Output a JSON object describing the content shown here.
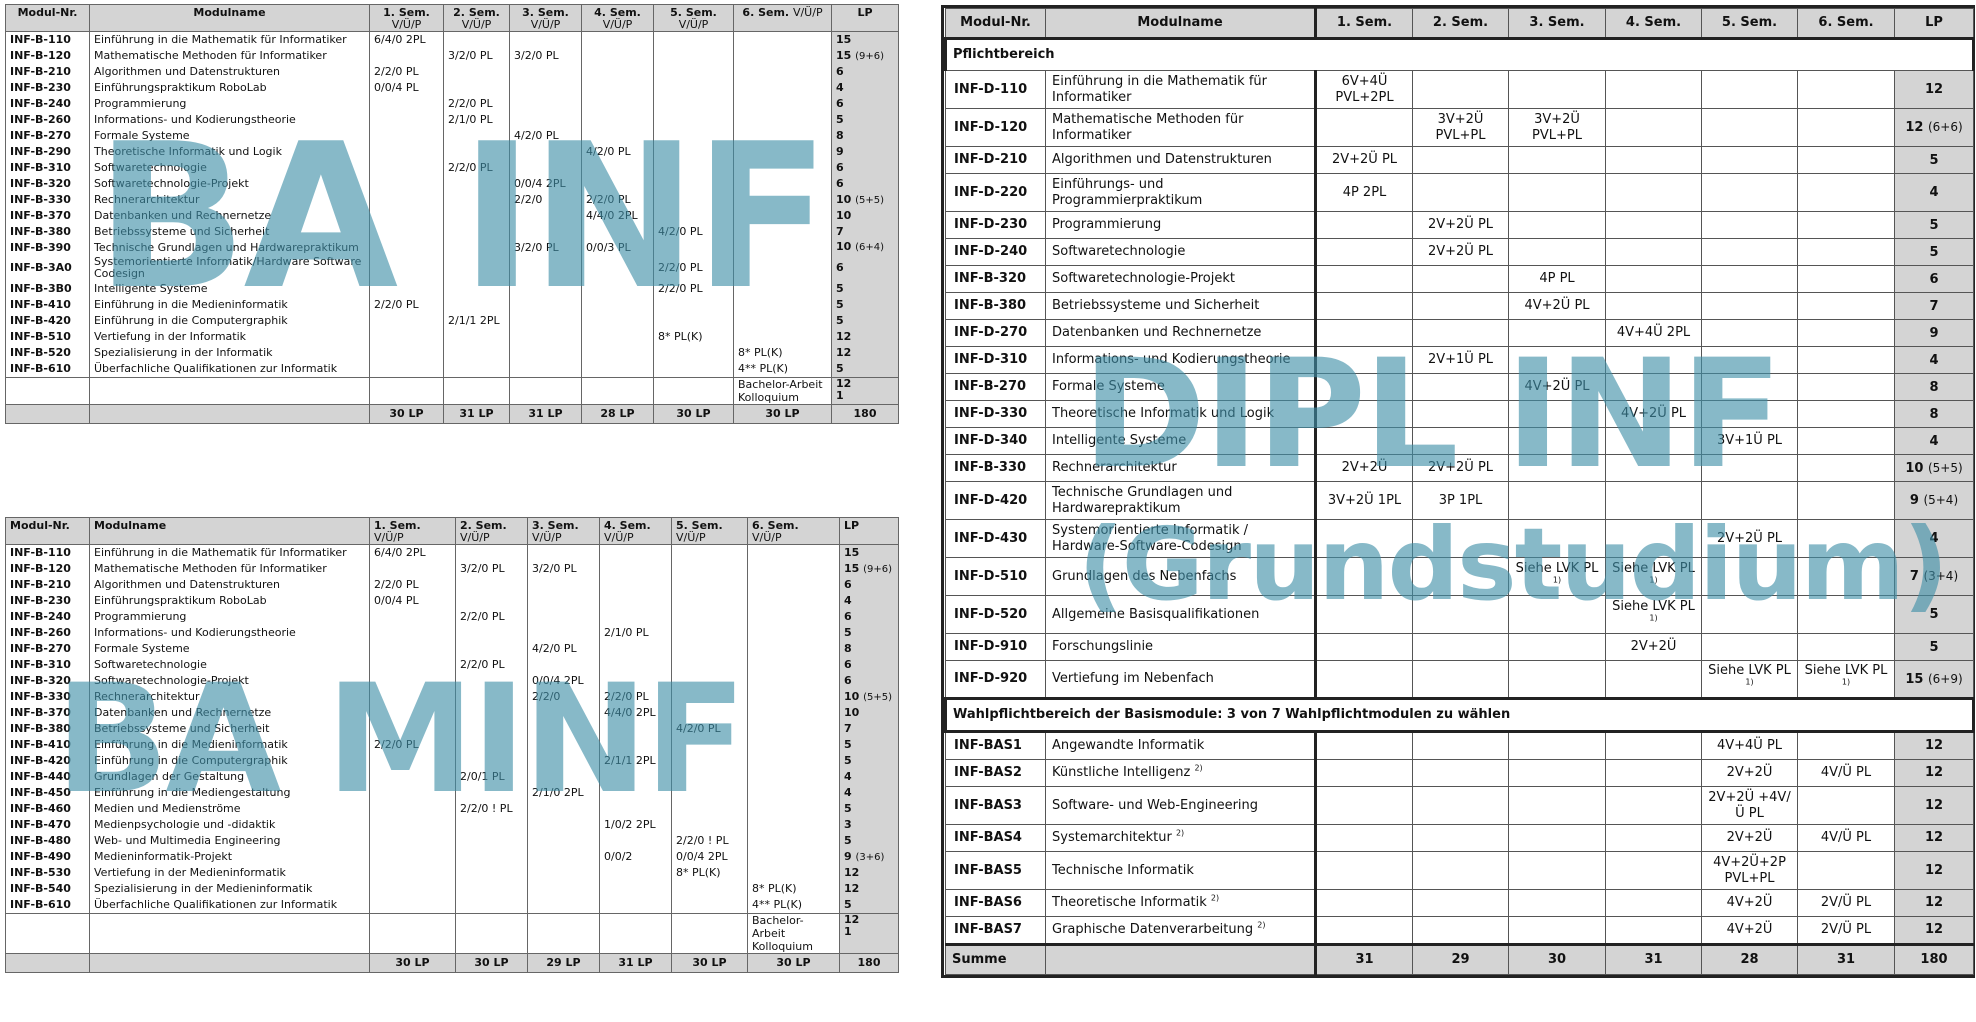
{
  "watermarks": {
    "bainf": "BA INF",
    "bamminf": "BA MINF",
    "diplinf": "DIPL INF",
    "grund": "(Grundstudium)"
  },
  "ba_inf": {
    "headers": {
      "nr": "Modul-Nr.",
      "name": "Modulname",
      "s1": "1. Sem.",
      "s2": "2. Sem.",
      "s3": "3. Sem.",
      "s4": "4. Sem.",
      "s5": "5. Sem.",
      "s6": "6. Sem.",
      "sub": "V/Ü/P",
      "lp": "LP"
    },
    "rows": [
      {
        "id": "INF-B-110",
        "name": "Einführung in die Mathematik für Informatiker",
        "s1": "6/4/0 2PL",
        "s2": "",
        "s3": "",
        "s4": "",
        "s5": "",
        "s6": "",
        "lp": "15",
        "lpx": ""
      },
      {
        "id": "INF-B-120",
        "name": "Mathematische Methoden für Informatiker",
        "s1": "",
        "s2": "3/2/0 PL",
        "s3": "3/2/0 PL",
        "s4": "",
        "s5": "",
        "s6": "",
        "lp": "15",
        "lpx": "(9+6)"
      },
      {
        "id": "INF-B-210",
        "name": "Algorithmen und Datenstrukturen",
        "s1": "2/2/0 PL",
        "s2": "",
        "s3": "",
        "s4": "",
        "s5": "",
        "s6": "",
        "lp": "6",
        "lpx": ""
      },
      {
        "id": "INF-B-230",
        "name": "Einführungspraktikum RoboLab",
        "s1": "0/0/4 PL",
        "s2": "",
        "s3": "",
        "s4": "",
        "s5": "",
        "s6": "",
        "lp": "4",
        "lpx": ""
      },
      {
        "id": "INF-B-240",
        "name": "Programmierung",
        "s1": "",
        "s2": "2/2/0 PL",
        "s3": "",
        "s4": "",
        "s5": "",
        "s6": "",
        "lp": "6",
        "lpx": ""
      },
      {
        "id": "INF-B-260",
        "name": "Informations- und Kodierungstheorie",
        "s1": "",
        "s2": "2/1/0 PL",
        "s3": "",
        "s4": "",
        "s5": "",
        "s6": "",
        "lp": "5",
        "lpx": ""
      },
      {
        "id": "INF-B-270",
        "name": "Formale Systeme",
        "s1": "",
        "s2": "",
        "s3": "4/2/0 PL",
        "s4": "",
        "s5": "",
        "s6": "",
        "lp": "8",
        "lpx": ""
      },
      {
        "id": "INF-B-290",
        "name": "Theoretische Informatik und Logik",
        "s1": "",
        "s2": "",
        "s3": "",
        "s4": "4/2/0 PL",
        "s5": "",
        "s6": "",
        "lp": "9",
        "lpx": ""
      },
      {
        "id": "INF-B-310",
        "name": "Softwaretechnologie",
        "s1": "",
        "s2": "2/2/0 PL",
        "s3": "",
        "s4": "",
        "s5": "",
        "s6": "",
        "lp": "6",
        "lpx": ""
      },
      {
        "id": "INF-B-320",
        "name": "Softwaretechnologie-Projekt",
        "s1": "",
        "s2": "",
        "s3": "0/0/4 2PL",
        "s4": "",
        "s5": "",
        "s6": "",
        "lp": "6",
        "lpx": ""
      },
      {
        "id": "INF-B-330",
        "name": "Rechnerarchitektur",
        "s1": "",
        "s2": "",
        "s3": "2/2/0",
        "s4": "2/2/0 PL",
        "s5": "",
        "s6": "",
        "lp": "10",
        "lpx": "(5+5)"
      },
      {
        "id": "INF-B-370",
        "name": "Datenbanken und Rechnernetze",
        "s1": "",
        "s2": "",
        "s3": "",
        "s4": "4/4/0 2PL",
        "s5": "",
        "s6": "",
        "lp": "10",
        "lpx": ""
      },
      {
        "id": "INF-B-380",
        "name": "Betriebssysteme und Sicherheit",
        "s1": "",
        "s2": "",
        "s3": "",
        "s4": "",
        "s5": "4/2/0 PL",
        "s6": "",
        "lp": "7",
        "lpx": ""
      },
      {
        "id": "INF-B-390",
        "name": "Technische Grundlagen und Hardwarepraktikum",
        "s1": "",
        "s2": "",
        "s3": "3/2/0 PL",
        "s4": "0/0/3 PL",
        "s5": "",
        "s6": "",
        "lp": "10",
        "lpx": "(6+4)"
      },
      {
        "id": "INF-B-3A0",
        "name": "Systemorientierte Informatik/Hardware Software Codesign",
        "s1": "",
        "s2": "",
        "s3": "",
        "s4": "",
        "s5": "2/2/0 PL",
        "s6": "",
        "lp": "6",
        "lpx": ""
      },
      {
        "id": "INF-B-3B0",
        "name": "Intelligente Systeme",
        "s1": "",
        "s2": "",
        "s3": "",
        "s4": "",
        "s5": "2/2/0 PL",
        "s6": "",
        "lp": "5",
        "lpx": ""
      },
      {
        "id": "INF-B-410",
        "name": "Einführung in die Medieninformatik",
        "s1": "2/2/0 PL",
        "s2": "",
        "s3": "",
        "s4": "",
        "s5": "",
        "s6": "",
        "lp": "5",
        "lpx": ""
      },
      {
        "id": "INF-B-420",
        "name": "Einführung in die Computergraphik",
        "s1": "",
        "s2": "2/1/1 2PL",
        "s3": "",
        "s4": "",
        "s5": "",
        "s6": "",
        "lp": "5",
        "lpx": ""
      },
      {
        "id": "INF-B-510",
        "name": "Vertiefung in der Informatik",
        "s1": "",
        "s2": "",
        "s3": "",
        "s4": "",
        "s5": "8* PL(K)",
        "s6": "",
        "lp": "12",
        "lpx": ""
      },
      {
        "id": "INF-B-520",
        "name": "Spezialisierung in der Informatik",
        "s1": "",
        "s2": "",
        "s3": "",
        "s4": "",
        "s5": "",
        "s6": "8* PL(K)",
        "lp": "12",
        "lpx": ""
      },
      {
        "id": "INF-B-610",
        "name": "Überfachliche Qualifikationen zur Informatik",
        "s1": "",
        "s2": "",
        "s3": "",
        "s4": "",
        "s5": "",
        "s6": "4** PL(K)",
        "lp": "5",
        "lpx": ""
      }
    ],
    "tail": {
      "s6": "Bachelor-Arbeit Kolloquium",
      "lp1": "12",
      "lp2": "1"
    },
    "sum": {
      "s1": "30 LP",
      "s2": "31 LP",
      "s3": "31 LP",
      "s4": "28 LP",
      "s5": "30 LP",
      "s6": "30 LP",
      "lp": "180"
    }
  },
  "ba_minf": {
    "headers": {
      "nr": "Modul-Nr.",
      "name": "Modulname",
      "s1": "1. Sem.",
      "s2": "2. Sem.",
      "s3": "3. Sem.",
      "s4": "4. Sem.",
      "s5": "5. Sem.",
      "s6": "6. Sem.",
      "sub": "V/Ü/P",
      "lp": "LP"
    },
    "rows": [
      {
        "id": "INF-B-110",
        "name": "Einführung in die Mathematik für Informatiker",
        "s1": "6/4/0 2PL",
        "s2": "",
        "s3": "",
        "s4": "",
        "s5": "",
        "s6": "",
        "lp": "15",
        "lpx": ""
      },
      {
        "id": "INF-B-120",
        "name": "Mathematische Methoden für Informatiker",
        "s1": "",
        "s2": "3/2/0 PL",
        "s3": "3/2/0 PL",
        "s4": "",
        "s5": "",
        "s6": "",
        "lp": "15",
        "lpx": "(9+6)"
      },
      {
        "id": "INF-B-210",
        "name": "Algorithmen und Datenstrukturen",
        "s1": "2/2/0 PL",
        "s2": "",
        "s3": "",
        "s4": "",
        "s5": "",
        "s6": "",
        "lp": "6",
        "lpx": ""
      },
      {
        "id": "INF-B-230",
        "name": "Einführungspraktikum RoboLab",
        "s1": "0/0/4 PL",
        "s2": "",
        "s3": "",
        "s4": "",
        "s5": "",
        "s6": "",
        "lp": "4",
        "lpx": ""
      },
      {
        "id": "INF-B-240",
        "name": "Programmierung",
        "s1": "",
        "s2": "2/2/0 PL",
        "s3": "",
        "s4": "",
        "s5": "",
        "s6": "",
        "lp": "6",
        "lpx": ""
      },
      {
        "id": "INF-B-260",
        "name": "Informations- und Kodierungstheorie",
        "s1": "",
        "s2": "",
        "s3": "",
        "s4": "2/1/0 PL",
        "s5": "",
        "s6": "",
        "lp": "5",
        "lpx": ""
      },
      {
        "id": "INF-B-270",
        "name": "Formale Systeme",
        "s1": "",
        "s2": "",
        "s3": "4/2/0 PL",
        "s4": "",
        "s5": "",
        "s6": "",
        "lp": "8",
        "lpx": ""
      },
      {
        "id": "INF-B-310",
        "name": "Softwaretechnologie",
        "s1": "",
        "s2": "2/2/0 PL",
        "s3": "",
        "s4": "",
        "s5": "",
        "s6": "",
        "lp": "6",
        "lpx": ""
      },
      {
        "id": "INF-B-320",
        "name": "Softwaretechnologie-Projekt",
        "s1": "",
        "s2": "",
        "s3": "0/0/4 2PL",
        "s4": "",
        "s5": "",
        "s6": "",
        "lp": "6",
        "lpx": ""
      },
      {
        "id": "INF-B-330",
        "name": "Rechnerarchitektur",
        "s1": "",
        "s2": "",
        "s3": "2/2/0",
        "s4": "2/2/0 PL",
        "s5": "",
        "s6": "",
        "lp": "10",
        "lpx": "(5+5)"
      },
      {
        "id": "INF-B-370",
        "name": "Datenbanken und Rechnernetze",
        "s1": "",
        "s2": "",
        "s3": "",
        "s4": "4/4/0 2PL",
        "s5": "",
        "s6": "",
        "lp": "10",
        "lpx": ""
      },
      {
        "id": "INF-B-380",
        "name": "Betriebssysteme und Sicherheit",
        "s1": "",
        "s2": "",
        "s3": "",
        "s4": "",
        "s5": "4/2/0 PL",
        "s6": "",
        "lp": "7",
        "lpx": ""
      },
      {
        "id": "INF-B-410",
        "name": "Einführung in die Medieninformatik",
        "s1": "2/2/0 PL",
        "s2": "",
        "s3": "",
        "s4": "",
        "s5": "",
        "s6": "",
        "lp": "5",
        "lpx": ""
      },
      {
        "id": "INF-B-420",
        "name": "Einführung in die Computergraphik",
        "s1": "",
        "s2": "",
        "s3": "",
        "s4": "2/1/1 2PL",
        "s5": "",
        "s6": "",
        "lp": "5",
        "lpx": ""
      },
      {
        "id": "INF-B-440",
        "name": "Grundlagen der Gestaltung",
        "s1": "",
        "s2": "2/0/1 PL",
        "s3": "",
        "s4": "",
        "s5": "",
        "s6": "",
        "lp": "4",
        "lpx": ""
      },
      {
        "id": "INF-B-450",
        "name": "Einführung in die Mediengestaltung",
        "s1": "",
        "s2": "",
        "s3": "2/1/0 2PL",
        "s4": "",
        "s5": "",
        "s6": "",
        "lp": "4",
        "lpx": ""
      },
      {
        "id": "INF-B-460",
        "name": "Medien und Medienströme",
        "s1": "",
        "s2": "2/2/0 ! PL",
        "s3": "",
        "s4": "",
        "s5": "",
        "s6": "",
        "lp": "5",
        "lpx": ""
      },
      {
        "id": "INF-B-470",
        "name": "Medienpsychologie und -didaktik",
        "s1": "",
        "s2": "",
        "s3": "",
        "s4": "1/0/2 2PL",
        "s5": "",
        "s6": "",
        "lp": "3",
        "lpx": ""
      },
      {
        "id": "INF-B-480",
        "name": "Web- und Multimedia Engineering",
        "s1": "",
        "s2": "",
        "s3": "",
        "s4": "",
        "s5": "2/2/0 ! PL",
        "s6": "",
        "lp": "5",
        "lpx": ""
      },
      {
        "id": "INF-B-490",
        "name": "Medieninformatik-Projekt",
        "s1": "",
        "s2": "",
        "s3": "",
        "s4": "0/0/2",
        "s5": "0/0/4 2PL",
        "s6": "",
        "lp": "9",
        "lpx": "(3+6)"
      },
      {
        "id": "INF-B-530",
        "name": "Vertiefung in der Medieninformatik",
        "s1": "",
        "s2": "",
        "s3": "",
        "s4": "",
        "s5": "8* PL(K)",
        "s6": "",
        "lp": "12",
        "lpx": ""
      },
      {
        "id": "INF-B-540",
        "name": "Spezialisierung in der Medieninformatik",
        "s1": "",
        "s2": "",
        "s3": "",
        "s4": "",
        "s5": "",
        "s6": "8* PL(K)",
        "lp": "12",
        "lpx": ""
      },
      {
        "id": "INF-B-610",
        "name": "Überfachliche Qualifikationen zur Informatik",
        "s1": "",
        "s2": "",
        "s3": "",
        "s4": "",
        "s5": "",
        "s6": "4** PL(K)",
        "lp": "5",
        "lpx": ""
      }
    ],
    "tail": {
      "s6": "Bachelor-Arbeit Kolloquium",
      "lp1": "12",
      "lp2": "1"
    },
    "sum": {
      "s1": "30 LP",
      "s2": "30 LP",
      "s3": "29 LP",
      "s4": "31 LP",
      "s5": "30 LP",
      "s6": "30 LP",
      "lp": "180"
    }
  },
  "dipl": {
    "headers": {
      "nr": "Modul-Nr.",
      "name": "Modulname",
      "s1": "1. Sem.",
      "s2": "2. Sem.",
      "s3": "3. Sem.",
      "s4": "4. Sem.",
      "s5": "5. Sem.",
      "s6": "6. Sem.",
      "lp": "LP"
    },
    "section1": "Pflichtbereich",
    "rows1": [
      {
        "id": "INF-D-110",
        "name": "Einführung in die Mathematik für Informatiker",
        "s1": "6V+4Ü PVL+2PL",
        "s2": "",
        "s3": "",
        "s4": "",
        "s5": "",
        "s6": "",
        "lp": "12",
        "lpx": ""
      },
      {
        "id": "INF-D-120",
        "name": "Mathematische Methoden für Informatiker",
        "s1": "",
        "s2": "3V+2Ü PVL+PL",
        "s3": "3V+2Ü PVL+PL",
        "s4": "",
        "s5": "",
        "s6": "",
        "lp": "12",
        "lpx": "(6+6)"
      },
      {
        "id": "INF-D-210",
        "name": "Algorithmen und Datenstrukturen",
        "s1": "2V+2Ü PL",
        "s2": "",
        "s3": "",
        "s4": "",
        "s5": "",
        "s6": "",
        "lp": "5",
        "lpx": ""
      },
      {
        "id": "INF-D-220",
        "name": "Einführungs- und Programmierpraktikum",
        "s1": "4P 2PL",
        "s2": "",
        "s3": "",
        "s4": "",
        "s5": "",
        "s6": "",
        "lp": "4",
        "lpx": ""
      },
      {
        "id": "INF-D-230",
        "name": "Programmierung",
        "s1": "",
        "s2": "2V+2Ü PL",
        "s3": "",
        "s4": "",
        "s5": "",
        "s6": "",
        "lp": "5",
        "lpx": ""
      },
      {
        "id": "INF-D-240",
        "name": "Softwaretechnologie",
        "s1": "",
        "s2": "2V+2Ü PL",
        "s3": "",
        "s4": "",
        "s5": "",
        "s6": "",
        "lp": "5",
        "lpx": ""
      },
      {
        "id": "INF-B-320",
        "name": "Softwaretechnologie-Projekt",
        "s1": "",
        "s2": "",
        "s3": "4P PL",
        "s4": "",
        "s5": "",
        "s6": "",
        "lp": "6",
        "lpx": ""
      },
      {
        "id": "INF-B-380",
        "name": "Betriebssysteme und Sicherheit",
        "s1": "",
        "s2": "",
        "s3": "4V+2Ü PL",
        "s4": "",
        "s5": "",
        "s6": "",
        "lp": "7",
        "lpx": ""
      },
      {
        "id": "INF-D-270",
        "name": "Datenbanken und Rechnernetze",
        "s1": "",
        "s2": "",
        "s3": "",
        "s4": "4V+4Ü 2PL",
        "s5": "",
        "s6": "",
        "lp": "9",
        "lpx": ""
      },
      {
        "id": "INF-D-310",
        "name": "Informations- und Kodierungstheorie",
        "s1": "",
        "s2": "2V+1Ü PL",
        "s3": "",
        "s4": "",
        "s5": "",
        "s6": "",
        "lp": "4",
        "lpx": ""
      },
      {
        "id": "INF-B-270",
        "name": "Formale Systeme",
        "s1": "",
        "s2": "",
        "s3": "4V+2Ü PL",
        "s4": "",
        "s5": "",
        "s6": "",
        "lp": "8",
        "lpx": ""
      },
      {
        "id": "INF-D-330",
        "name": "Theoretische Informatik und Logik",
        "s1": "",
        "s2": "",
        "s3": "",
        "s4": "4V+2Ü PL",
        "s5": "",
        "s6": "",
        "lp": "8",
        "lpx": ""
      },
      {
        "id": "INF-D-340",
        "name": "Intelligente Systeme",
        "s1": "",
        "s2": "",
        "s3": "",
        "s4": "",
        "s5": "3V+1Ü PL",
        "s6": "",
        "lp": "4",
        "lpx": ""
      },
      {
        "id": "INF-B-330",
        "name": "Rechnerarchitektur",
        "s1": "2V+2Ü",
        "s2": "2V+2Ü PL",
        "s3": "",
        "s4": "",
        "s5": "",
        "s6": "",
        "lp": "10",
        "lpx": "(5+5)"
      },
      {
        "id": "INF-D-420",
        "name": "Technische Grundlagen und Hardwarepraktikum",
        "s1": "3V+2Ü 1PL",
        "s2": "3P 1PL",
        "s3": "",
        "s4": "",
        "s5": "",
        "s6": "",
        "lp": "9",
        "lpx": "(5+4)"
      },
      {
        "id": "INF-D-430",
        "name": "Systemorientierte Informatik / Hardware-Software-Codesign",
        "s1": "",
        "s2": "",
        "s3": "",
        "s4": "",
        "s5": "2V+2Ü PL",
        "s6": "",
        "lp": "4",
        "lpx": ""
      },
      {
        "id": "INF-D-510",
        "name": "Grundlagen des Nebenfachs",
        "s1": "",
        "s2": "",
        "s3": "Siehe LVK PL",
        "s3sup": "1)",
        "s4": "Siehe LVK PL",
        "s4sup": "1)",
        "s5": "",
        "s6": "",
        "lp": "7",
        "lpx": "(3+4)"
      },
      {
        "id": "INF-D-520",
        "name": "Allgemeine Basisqualifikationen",
        "s1": "",
        "s2": "",
        "s3": "",
        "s4": "Siehe LVK PL",
        "s4sup": "1)",
        "s5": "",
        "s6": "",
        "lp": "5",
        "lpx": ""
      },
      {
        "id": "INF-D-910",
        "name": "Forschungslinie",
        "s1": "",
        "s2": "",
        "s3": "",
        "s4": "2V+2Ü",
        "s5": "",
        "s6": "",
        "lp": "5",
        "lpx": ""
      },
      {
        "id": "INF-D-920",
        "name": "Vertiefung im Nebenfach",
        "s1": "",
        "s2": "",
        "s3": "",
        "s4": "",
        "s5": "Siehe LVK PL",
        "s5sup": "1)",
        "s6": "Siehe LVK PL",
        "s6sup": "1)",
        "lp": "15",
        "lpx": "(6+9)"
      }
    ],
    "section2": "Wahlpflichtbereich der Basismodule: 3 von 7 Wahlpflichtmodulen zu wählen",
    "rows2": [
      {
        "id": "INF-BAS1",
        "name": "Angewandte Informatik",
        "namesup": "",
        "s5": "4V+4Ü PL",
        "s6": "",
        "lp": "12"
      },
      {
        "id": "INF-BAS2",
        "name": "Künstliche Intelligenz",
        "namesup": "2)",
        "s5": "2V+2Ü",
        "s6": "4V/Ü PL",
        "lp": "12"
      },
      {
        "id": "INF-BAS3",
        "name": "Software- und Web-Engineering",
        "namesup": "",
        "s5": "2V+2Ü +4V/Ü PL",
        "s6": "",
        "lp": "12"
      },
      {
        "id": "INF-BAS4",
        "name": "Systemarchitektur",
        "namesup": "2)",
        "s5": "2V+2Ü",
        "s6": "4V/Ü PL",
        "lp": "12"
      },
      {
        "id": "INF-BAS5",
        "name": "Technische Informatik",
        "namesup": "",
        "s5": "4V+2Ü+2P PVL+PL",
        "s6": "",
        "lp": "12"
      },
      {
        "id": "INF-BAS6",
        "name": "Theoretische Informatik",
        "namesup": "2)",
        "s5": "4V+2Ü",
        "s6": "2V/Ü PL",
        "lp": "12"
      },
      {
        "id": "INF-BAS7",
        "name": "Graphische Datenverarbeitung",
        "namesup": "2)",
        "s5": "4V+2Ü",
        "s6": "2V/Ü PL",
        "lp": "12"
      }
    ],
    "sum": {
      "label": "Summe",
      "s1": "31",
      "s2": "29",
      "s3": "30",
      "s4": "31",
      "s5": "28",
      "s6": "31",
      "lp": "180"
    }
  }
}
